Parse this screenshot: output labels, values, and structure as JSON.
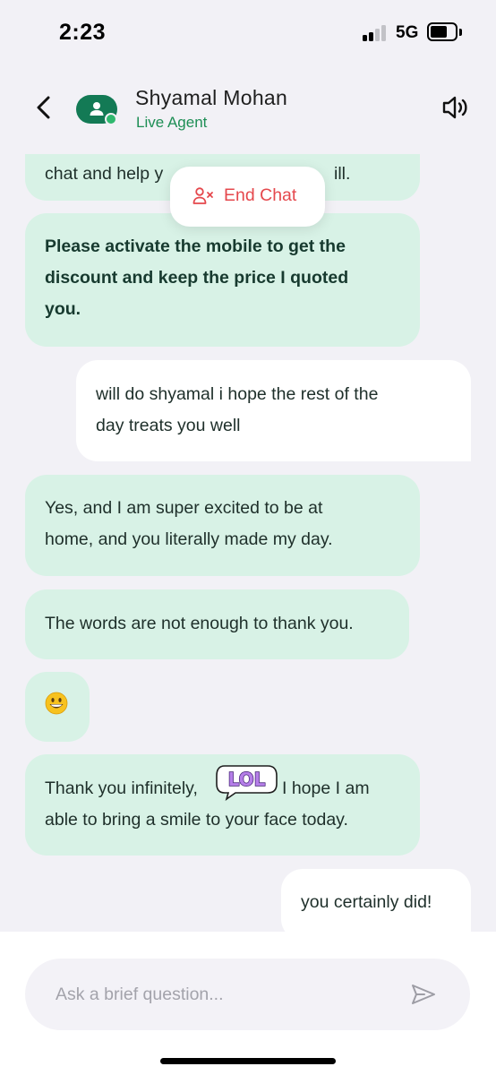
{
  "status_bar": {
    "time": "2:23",
    "network": "5G",
    "battery_level": 0.7
  },
  "header": {
    "agent_name": "Shyamal Mohan",
    "agent_status": "Live Agent"
  },
  "end_chat": {
    "label": "End Chat"
  },
  "messages": [
    {
      "from": "agent",
      "lines": [
        "chat and help y",
        "ill."
      ]
    },
    {
      "from": "agent",
      "bold": true,
      "lines": [
        "Please activate the mobile to get the",
        "discount and keep the price I quoted",
        "you."
      ]
    },
    {
      "from": "user",
      "lines": [
        "will do shyamal i hope the rest of the",
        "day treats you well"
      ]
    },
    {
      "from": "agent",
      "lines": [
        "Yes, and I am super excited to be at",
        "home, and you literally made my day."
      ]
    },
    {
      "from": "agent",
      "lines": [
        "The words are not enough to thank you."
      ]
    },
    {
      "from": "agent",
      "emoji": "grinning-face"
    },
    {
      "from": "agent",
      "lines": [
        "Thank you infinitely,",
        "I hope I am",
        "able to bring a smile to your face today."
      ],
      "sticker": "LOL"
    },
    {
      "from": "user",
      "lines": [
        "you certainly did!"
      ]
    }
  ],
  "composer": {
    "placeholder": "Ask a brief question..."
  },
  "colors": {
    "agent_bubble": "#d8f2e6",
    "user_bubble": "#ffffff",
    "accent_green": "#137a55",
    "live_green": "#1e8e55",
    "end_chat_red": "#e5484d",
    "background": "#f2f1f6"
  },
  "icons": {
    "back": "chevron-left-icon",
    "avatar": "person-icon",
    "speaker": "speaker-icon",
    "end_chat": "user-x-icon",
    "send": "send-icon"
  }
}
